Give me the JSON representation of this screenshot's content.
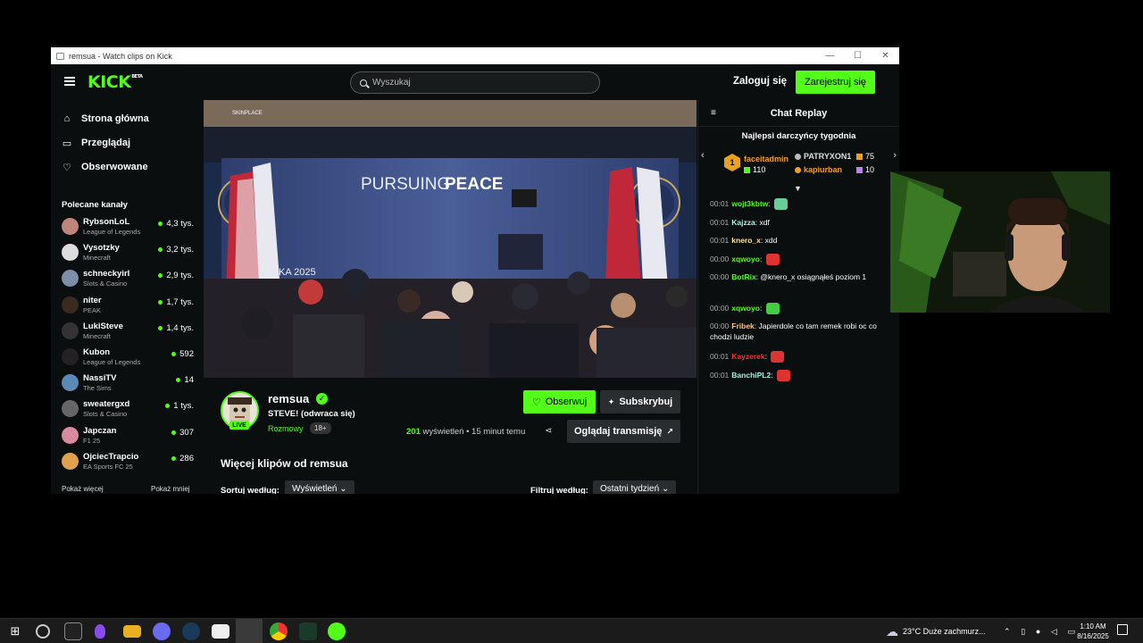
{
  "window": {
    "title": "remsua - Watch clips on Kick",
    "min": "—",
    "max": "☐",
    "close": "✕"
  },
  "header": {
    "logo": "KICK",
    "logo_sup": "BETA",
    "search_placeholder": "Wyszukaj",
    "login": "Zaloguj się",
    "register": "Zarejestruj się"
  },
  "sidebar": {
    "nav": [
      {
        "label": "Strona główna"
      },
      {
        "label": "Przeglądaj"
      },
      {
        "label": "Obserwowane"
      }
    ],
    "recommended_title": "Polecane kanały",
    "channels": [
      {
        "name": "RybsonLoL",
        "category": "League of Legends",
        "viewers": "4,3 tys.",
        "color": "#c0857a"
      },
      {
        "name": "Vysotzky",
        "category": "Minecraft",
        "viewers": "3,2 tys.",
        "color": "#ddd"
      },
      {
        "name": "schneckyirl",
        "category": "Slots & Casino",
        "viewers": "2,9 tys.",
        "color": "#7d8fa8"
      },
      {
        "name": "niter",
        "category": "PEAK",
        "viewers": "1,7 tys.",
        "color": "#3a2a20"
      },
      {
        "name": "LukiSteve",
        "category": "Minecraft",
        "viewers": "1,4 tys.",
        "color": "#333"
      },
      {
        "name": "Kubon",
        "category": "League of Legends",
        "viewers": "592",
        "color": "#222"
      },
      {
        "name": "NassiTV",
        "category": "The Sims",
        "viewers": "14",
        "color": "#5a8ab5"
      },
      {
        "name": "sweatergxd",
        "category": "Slots & Casino",
        "viewers": "1 tys.",
        "color": "#666"
      },
      {
        "name": "Japczan",
        "category": "F1 25",
        "viewers": "307",
        "color": "#d88aa0"
      },
      {
        "name": "OjciecTrapcio",
        "category": "EA Sports FC 25",
        "viewers": "286",
        "color": "#e0a050"
      }
    ],
    "show_more": "Pokaż więcej",
    "show_less": "Pokaż mniej"
  },
  "video": {
    "backdrop_text": "PURSUING",
    "backdrop_text_bold": "PEACE",
    "small_backdrop": "PURSUING PEACE",
    "year_text": "KA 2025",
    "brand": "SKINPLACE"
  },
  "clip": {
    "streamer": "remsua",
    "live": "LIVE",
    "title": "STEVE! (odwraca się)",
    "category": "Rozmowy",
    "age": "18+",
    "follow": "Obserwuj",
    "subscribe": "Subskrybuj",
    "view_count": "201",
    "views_label": "wyświetleń",
    "time": "15 minut temu",
    "watch": "Oglądaj transmisję",
    "more_clips": "Więcej klipów od remsua",
    "sort_label": "Sortuj według:",
    "sort_value": "Wyświetleń",
    "filter_label": "Filtruj według:",
    "filter_value": "Ostatni tydzień"
  },
  "chat": {
    "title": "Chat Replay",
    "gifters_title": "Najlepsi darczyńcy tygodnia",
    "rank1": "1",
    "gifters": [
      {
        "name": "faceitadmin",
        "count": "110",
        "color": "#f0a020"
      },
      {
        "name": "PATRYXON1",
        "count": "75",
        "color": "#ddd"
      },
      {
        "name": "kapiurban",
        "count": "10",
        "color": "#f0a020"
      }
    ],
    "messages": [
      {
        "time": "00:01",
        "user": "wojt3kbtw",
        "text": "",
        "color": "#53fc18",
        "emote": "#6c9"
      },
      {
        "time": "00:01",
        "user": "Kajzza",
        "text": "xdf",
        "color": "#a8f0e0",
        "emote": ""
      },
      {
        "time": "00:01",
        "user": "knero_x",
        "text": "xdd",
        "color": "#ffe0a0",
        "emote": ""
      },
      {
        "time": "00:00",
        "user": "xqwoyo",
        "text": "",
        "color": "#53fc18",
        "emote": "#d33"
      },
      {
        "time": "00:00",
        "user": "BotRix",
        "text": "@knero_x osiągnąłeś poziom 1",
        "color": "#53fc18",
        "emote": ""
      },
      {
        "time": "00:00",
        "user": "xqwoyo",
        "text": "",
        "color": "#53fc18",
        "emote": "#4c4"
      },
      {
        "time": "00:00",
        "user": "Fribek",
        "text": "Japierdole co tam remek robi oc co chodzi ludzie",
        "color": "#ffc080",
        "emote": ""
      },
      {
        "time": "00:01",
        "user": "Kayzerek",
        "text": "",
        "color": "#e33",
        "emote": "#d33"
      },
      {
        "time": "00:01",
        "user": "BanchiPL2",
        "text": "",
        "color": "#a8f0e0",
        "emote": "#d33"
      }
    ]
  },
  "taskbar": {
    "weather": "23°C  Duże zachmurz...",
    "time": "1:10 AM",
    "date": "8/16/2025"
  },
  "colors": {
    "accent": "#53fc18",
    "bg": "#0b0e0f"
  }
}
